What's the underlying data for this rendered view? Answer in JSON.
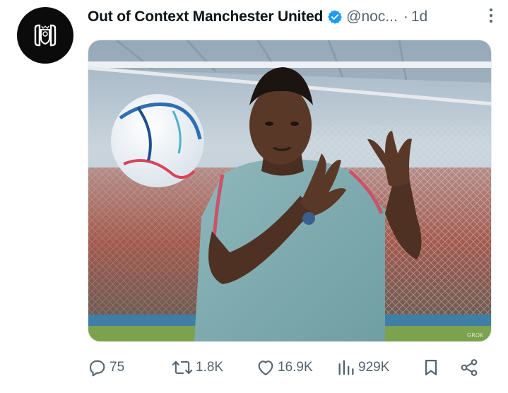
{
  "post": {
    "author_name": "Out of Context Manchester United",
    "handle": "@noc...",
    "separator": "·",
    "time": "1d",
    "media_watermark": "GROK"
  },
  "actions": {
    "replies": "75",
    "reposts": "1.8K",
    "likes": "16.9K",
    "views": "929K"
  },
  "icons": {
    "verified": "verified-badge-icon",
    "more": "more-vertical-icon",
    "reply": "reply-icon",
    "repost": "repost-icon",
    "like": "heart-icon",
    "views": "views-chart-icon",
    "bookmark": "bookmark-icon",
    "share": "share-icon"
  },
  "colors": {
    "verified_blue": "#1d9bf0",
    "secondary_text": "#536471",
    "primary_text": "#0f1419",
    "avatar_bg": "#0b0b0b"
  }
}
